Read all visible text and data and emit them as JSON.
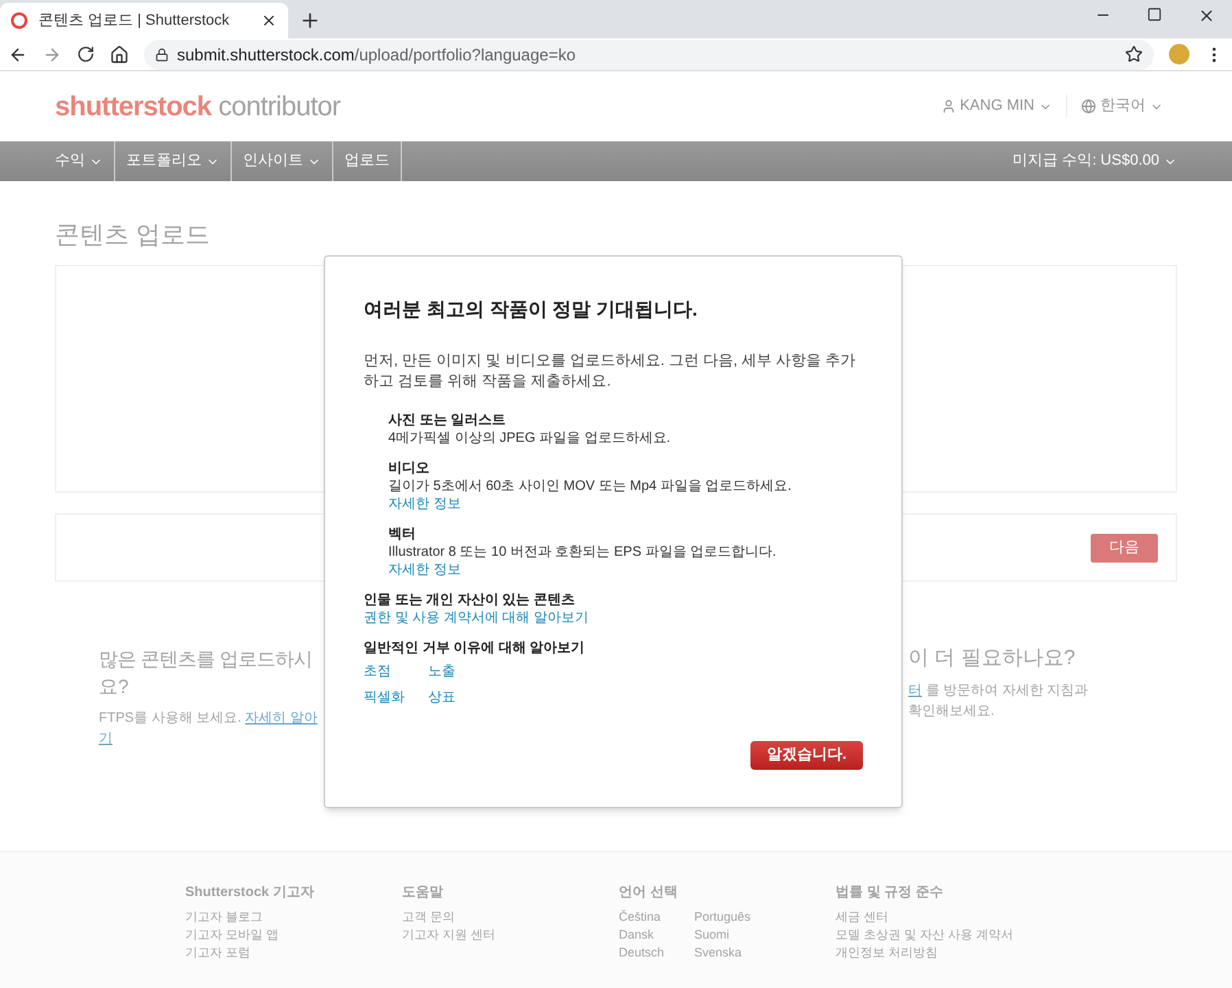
{
  "browser": {
    "tab_title": "콘텐츠 업로드 | Shutterstock",
    "url_host": "submit.shutterstock.com",
    "url_path": "/upload/portfolio?language=ko"
  },
  "header": {
    "logo_brand": "shutterstock",
    "logo_suffix": "contributor",
    "user": "KANG MIN",
    "language": "한국어"
  },
  "nav": {
    "items": [
      {
        "label": "수익",
        "dropdown": true
      },
      {
        "label": "포트폴리오",
        "dropdown": true
      },
      {
        "label": "인사이트",
        "dropdown": true
      },
      {
        "label": "업로드",
        "dropdown": false
      }
    ],
    "earnings": "미지급 수익: US$0.00"
  },
  "page_title": "콘텐츠 업로드",
  "next_button": {
    "label": "다음",
    "disabled": true
  },
  "help_left": {
    "heading": "많은 콘텐츠를 업로드하시",
    "heading_end": "요?",
    "text": "FTPS를 사용해 보세요.",
    "link": "자세히 알아",
    "link_end": "기"
  },
  "help_right": {
    "heading": "이 더 필요하나요?",
    "link": "터",
    "text": "를 방문하여 자세한 지침과",
    "text_end": "확인해보세요."
  },
  "modal": {
    "title": "여러분 최고의 작품이 정말 기대됩니다.",
    "intro": "먼저, 만든 이미지 및 비디오를 업로드하세요. 그런 다음, 세부 사항을 추가하고 검토를 위해 작품을 제출하세요.",
    "file_types": [
      {
        "name": "사진 또는 일러스트",
        "description": "4메가픽셀 이상의 JPEG 파일을 업로드하세요."
      },
      {
        "name": "비디오",
        "description": "길이가 5초에서 60초 사이인 MOV 또는 Mp4 파일을 업로드하세요.",
        "link": "자세한 정보"
      },
      {
        "name": "벡터",
        "description": "Illustrator 8 또는 10 버전과 호환되는 EPS 파일을 업로드합니다.",
        "link": "자세한 정보"
      }
    ],
    "people": {
      "heading": "인물 또는 개인 자산이 있는 콘텐츠",
      "link": "권한 및 사용 계약서에 대해 알아보기"
    },
    "rejection": {
      "heading": "일반적인 거부 이유에 대해 알아보기",
      "links": [
        "초점",
        "노출",
        "픽셀화",
        "상표"
      ]
    },
    "ok_button": "알겠습니다."
  },
  "footer": {
    "columns": [
      {
        "heading": "Shutterstock 기고자",
        "links": [
          "기고자 블로그",
          "기고자 모바일 앱",
          "기고자 포럼"
        ]
      },
      {
        "heading": "도움말",
        "links": [
          "고객 문의",
          "기고자 지원 센터"
        ]
      },
      {
        "heading": "언어 선택",
        "links": [
          "Čeština",
          "Português",
          "Dansk",
          "Suomi",
          "Deutsch",
          "Svenska"
        ]
      },
      {
        "heading": "법률 및 규정 준수",
        "links": [
          "세금 센터",
          "모델 초상권 및 자산 사용 계약서",
          "개인정보 처리방침"
        ]
      }
    ]
  }
}
